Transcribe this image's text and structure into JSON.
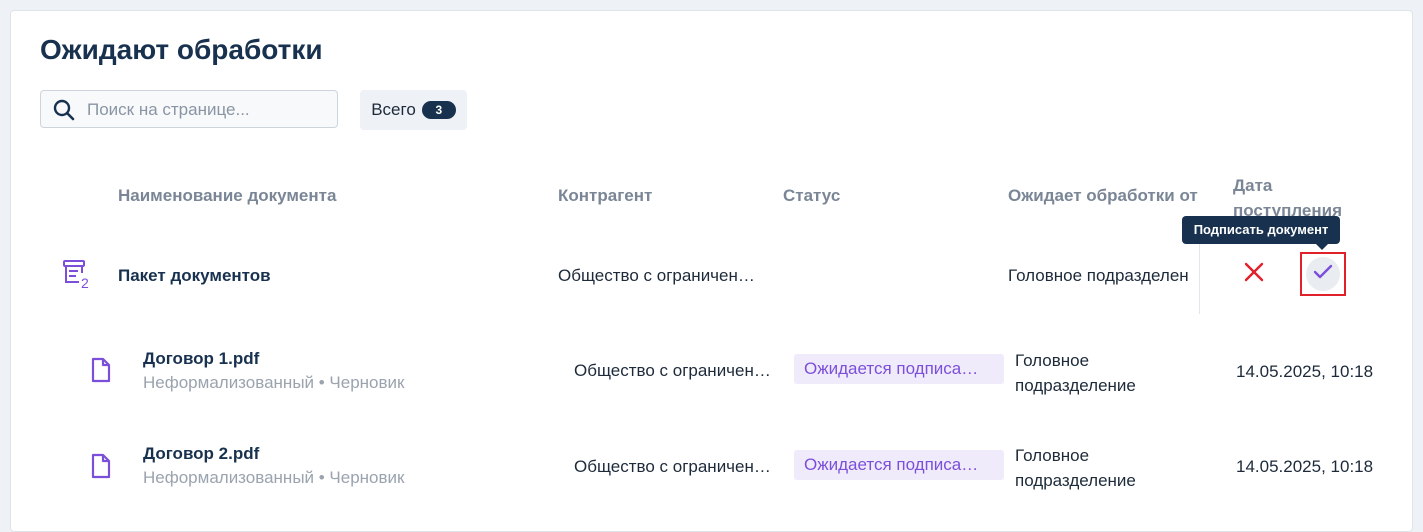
{
  "page": {
    "title": "Ожидают обработки"
  },
  "search": {
    "placeholder": "Поиск на странице...",
    "value": ""
  },
  "total": {
    "label": "Всего",
    "count": "3"
  },
  "table": {
    "columns": [
      "Наименование документа",
      "Контрагент",
      "Статус",
      "Ожидает обработки от",
      "Дата поступления"
    ],
    "package": {
      "name": "Пакет документов",
      "icon": "document-package-icon",
      "icon_badge": "2",
      "counterparty": "Общество с ограничен…",
      "awaiting_from": "Головное подразделен"
    },
    "rows": [
      {
        "name": "Договор 1.pdf",
        "meta": "Неформализованный • Черновик",
        "counterparty": "Общество с ограничен…",
        "status": "Ожидается подписа…",
        "awaiting_from": "Головное подразделение",
        "date": "14.05.2025, 10:18"
      },
      {
        "name": "Договор 2.pdf",
        "meta": "Неформализованный • Черновик",
        "counterparty": "Общество с ограничен…",
        "status": "Ожидается подписа…",
        "awaiting_from": "Головное подразделение",
        "date": "14.05.2025, 10:18"
      }
    ]
  },
  "actions": {
    "reject_icon": "close-icon",
    "sign_icon": "checkmark-icon",
    "sign_tooltip": "Подписать документ"
  },
  "colors": {
    "accent": "#7b4fd9",
    "title": "#17314f",
    "reject": "#e0202a",
    "highlight_border": "#e0202a"
  }
}
